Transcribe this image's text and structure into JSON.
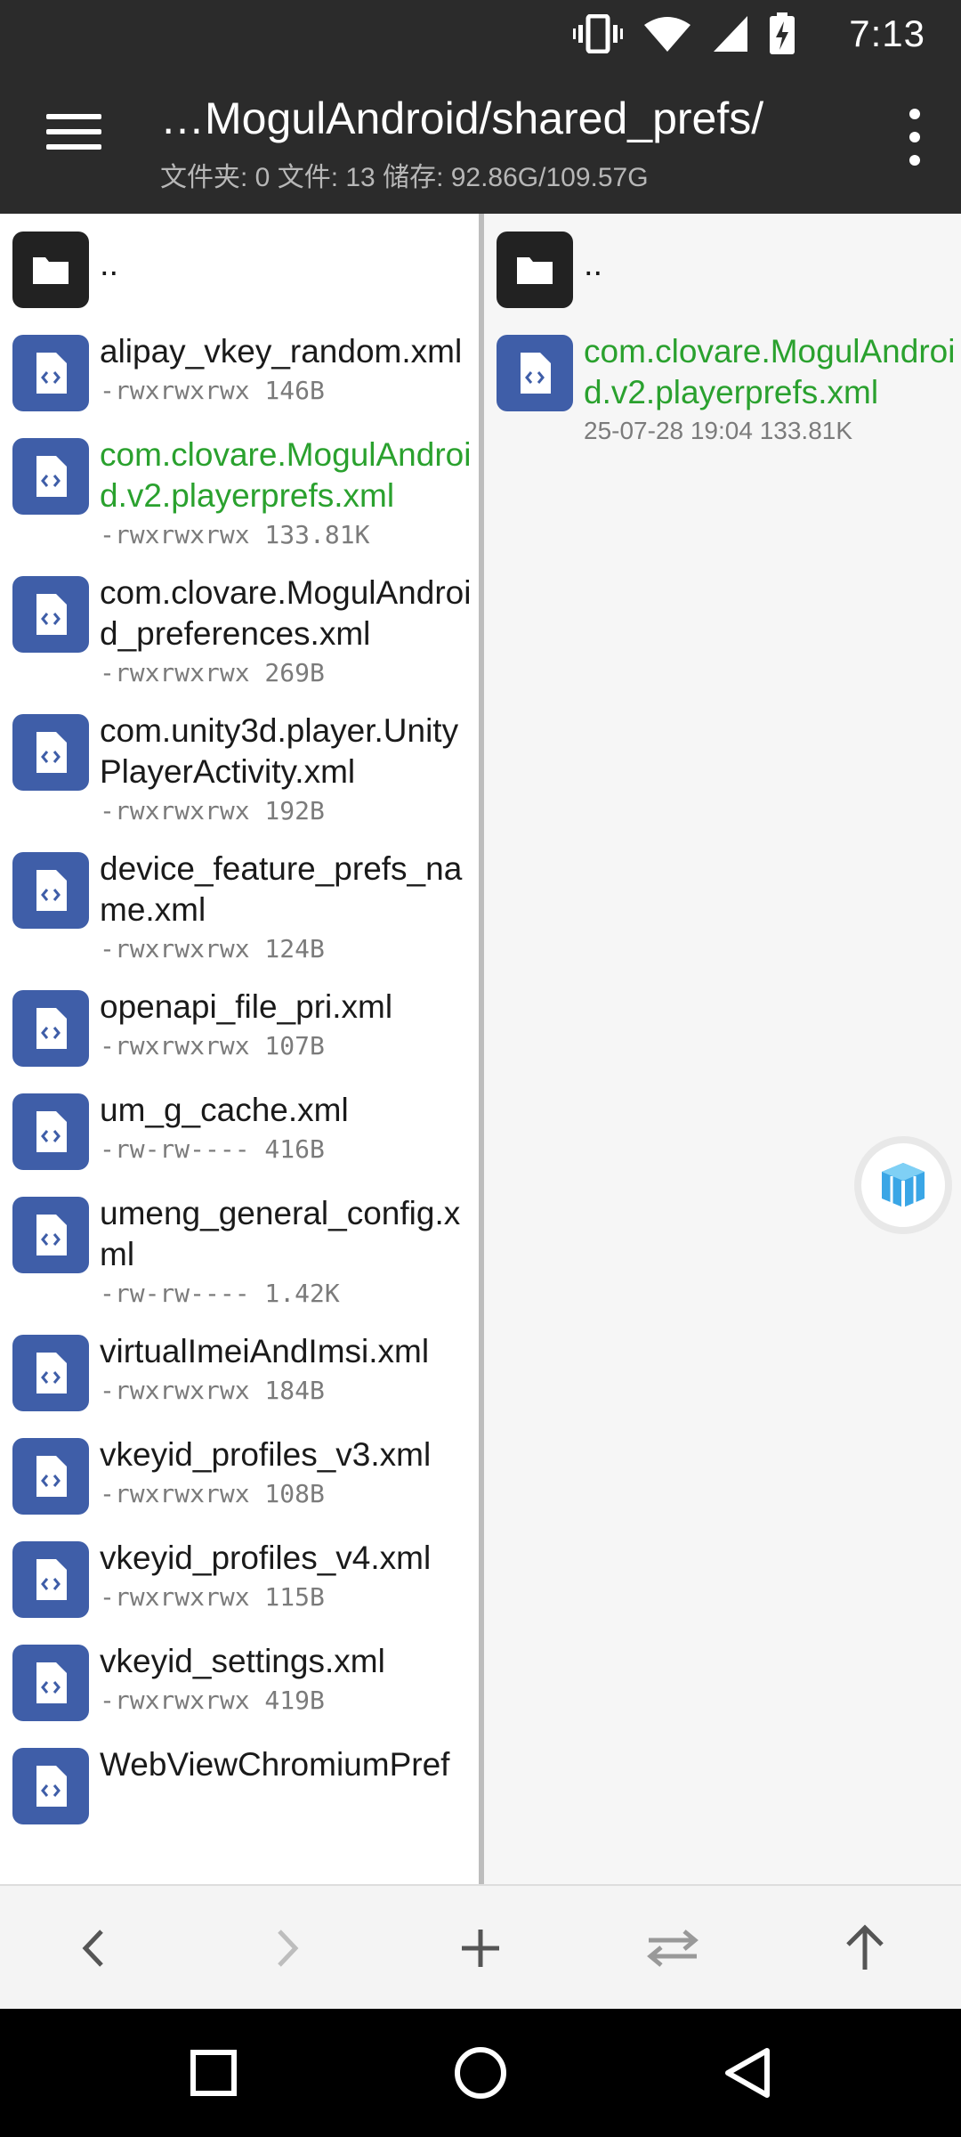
{
  "status_bar": {
    "time": "7:13"
  },
  "app_bar": {
    "title": "…MogulAndroid/shared_prefs/",
    "subtitle": "文件夹: 0  文件: 13  储存: 92.86G/109.57G"
  },
  "left_pane": {
    "parent": "..",
    "files": [
      {
        "name": "alipay_vkey_random.xml",
        "meta": "-rwxrwxrwx 146B",
        "highlight": false
      },
      {
        "name": "com.clovare.MogulAndroid.v2.playerprefs.xml",
        "meta": "-rwxrwxrwx 133.81K",
        "highlight": true
      },
      {
        "name": "com.clovare.MogulAndroid_preferences.xml",
        "meta": "-rwxrwxrwx 269B",
        "highlight": false
      },
      {
        "name": "com.unity3d.player.UnityPlayerActivity.xml",
        "meta": "-rwxrwxrwx 192B",
        "highlight": false
      },
      {
        "name": "device_feature_prefs_name.xml",
        "meta": "-rwxrwxrwx 124B",
        "highlight": false
      },
      {
        "name": "openapi_file_pri.xml",
        "meta": "-rwxrwxrwx 107B",
        "highlight": false
      },
      {
        "name": "um_g_cache.xml",
        "meta": "-rw-rw---- 416B",
        "highlight": false
      },
      {
        "name": "umeng_general_config.xml",
        "meta": "-rw-rw---- 1.42K",
        "highlight": false
      },
      {
        "name": "virtualImeiAndImsi.xml",
        "meta": "-rwxrwxrwx 184B",
        "highlight": false
      },
      {
        "name": "vkeyid_profiles_v3.xml",
        "meta": "-rwxrwxrwx 108B",
        "highlight": false
      },
      {
        "name": "vkeyid_profiles_v4.xml",
        "meta": "-rwxrwxrwx 115B",
        "highlight": false
      },
      {
        "name": "vkeyid_settings.xml",
        "meta": "-rwxrwxrwx 419B",
        "highlight": false
      },
      {
        "name": "WebViewChromiumPref",
        "meta": "",
        "highlight": false
      }
    ]
  },
  "right_pane": {
    "parent": "..",
    "files": [
      {
        "name": "com.clovare.MogulAndroid.v2.playerprefs.xml",
        "meta": "25-07-28 19:04  133.81K",
        "highlight": true
      }
    ]
  },
  "icons": {
    "folder": "folder-icon",
    "file": "xml-file-icon",
    "float": "cube-icon"
  },
  "colors": {
    "bar": "#2b2b2b",
    "file_icon": "#3f5ea8",
    "highlight": "#2aa12e"
  }
}
